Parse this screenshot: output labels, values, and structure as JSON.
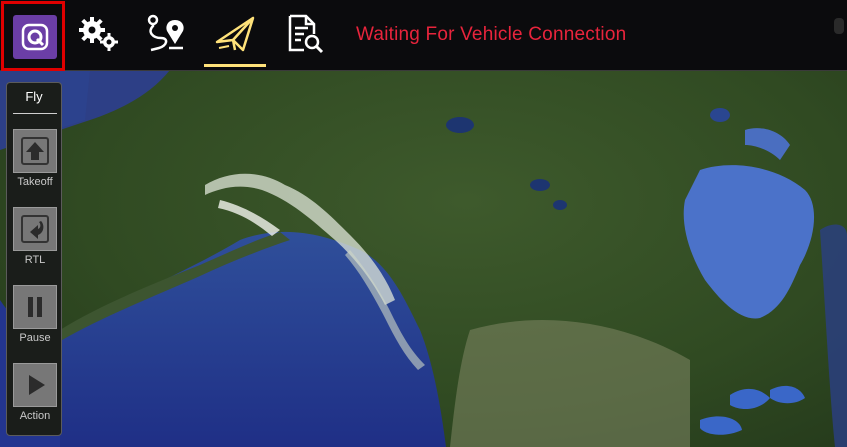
{
  "toolbar": {
    "status_message": "Waiting For Vehicle Connection",
    "buttons": [
      {
        "name": "app-menu",
        "icon": "qgc-logo-icon",
        "highlighted": true
      },
      {
        "name": "settings",
        "icon": "gears-icon"
      },
      {
        "name": "plan",
        "icon": "route-waypoint-icon"
      },
      {
        "name": "fly",
        "icon": "paper-plane-icon",
        "active": true
      },
      {
        "name": "analyze",
        "icon": "document-search-icon"
      }
    ]
  },
  "tool_strip": {
    "title": "Fly",
    "tools": [
      {
        "label": "Takeoff",
        "icon": "takeoff-arrow-icon"
      },
      {
        "label": "RTL",
        "icon": "return-arrow-icon"
      },
      {
        "label": "Pause",
        "icon": "pause-icon"
      },
      {
        "label": "Action",
        "icon": "play-icon"
      }
    ]
  },
  "colors": {
    "status_red": "#e8243c",
    "highlight_red": "#e00000",
    "app_purple": "#6b3ea6",
    "active_underline": "#ffe27a",
    "toolbar_bg": "#0b0b0d"
  }
}
